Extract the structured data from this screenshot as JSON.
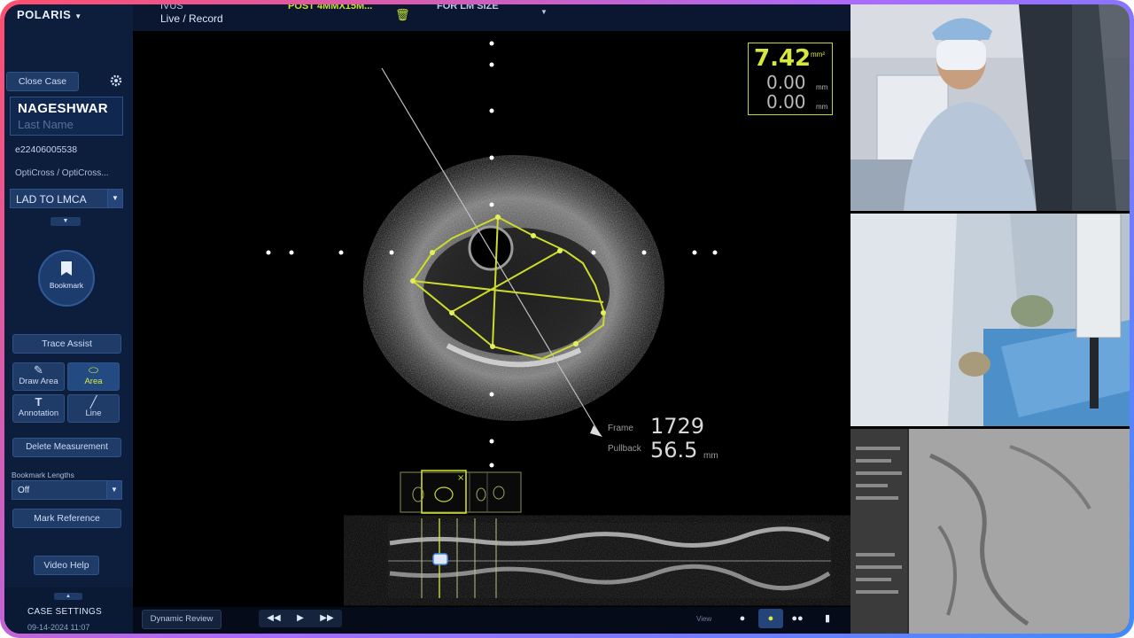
{
  "app": {
    "brand": "POLARIS",
    "mode_top": "IVUS",
    "mode_sub": "Live / Record",
    "pullback_name": "POST 4MMX15M...",
    "size_label": "FOR LM SIZE"
  },
  "sidebar": {
    "close_case": "Close Case",
    "patient_first": "NAGESHWAR",
    "patient_last_placeholder": "Last Name",
    "patient_id": "e22406005538",
    "device": "OptiCross / OptiCross...",
    "vessel": "LAD TO LMCA",
    "bookmark": "Bookmark",
    "trace_assist": "Trace Assist",
    "tools": [
      {
        "label": "Draw Area",
        "icon": "draw-area-icon"
      },
      {
        "label": "Area",
        "icon": "area-icon"
      },
      {
        "label": "Annotation",
        "icon": "text-icon"
      },
      {
        "label": "Line",
        "icon": "line-icon"
      }
    ],
    "delete_measurement": "Delete Measurement",
    "bookmark_lengths_label": "Bookmark Lengths",
    "bookmark_lengths_value": "Off",
    "mark_reference": "Mark Reference",
    "video_help": "Video Help",
    "case_settings": "CASE SETTINGS",
    "case_date": "09-14-2024 11:07"
  },
  "measurement": {
    "area_value": "7.42",
    "area_unit": "mm²",
    "row1_value": "0.00",
    "row1_unit": "mm",
    "row2_value": "0.00",
    "row2_unit": "mm"
  },
  "frame_info": {
    "frame_label": "Frame",
    "frame_value": "1729",
    "pullback_label": "Pullback",
    "pullback_value": "56.5",
    "pullback_unit": "mm"
  },
  "controls": {
    "dynamic_review": "Dynamic Review",
    "view_label": "View"
  },
  "colors": {
    "accent": "#d7e83c",
    "panel": "#0c1e3c",
    "button": "#1f3b68"
  }
}
